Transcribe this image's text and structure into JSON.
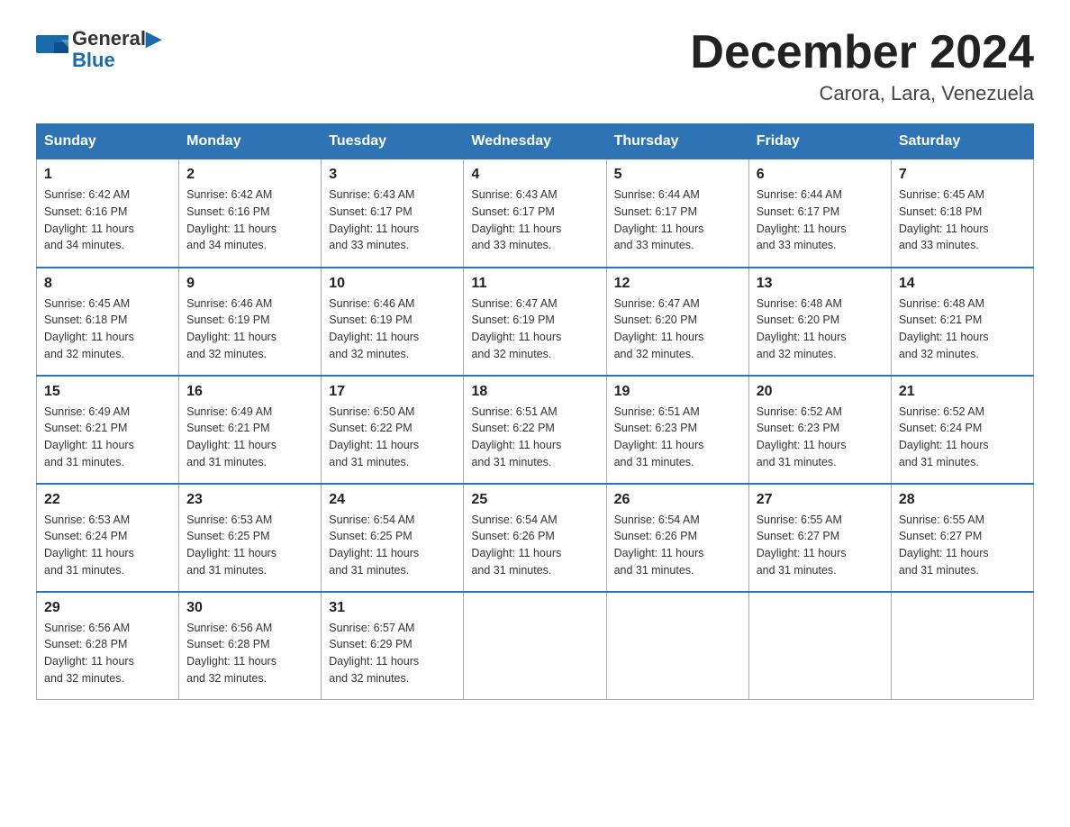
{
  "header": {
    "logo_text_general": "General",
    "logo_text_blue": "Blue",
    "title": "December 2024",
    "subtitle": "Carora, Lara, Venezuela"
  },
  "weekdays": [
    "Sunday",
    "Monday",
    "Tuesday",
    "Wednesday",
    "Thursday",
    "Friday",
    "Saturday"
  ],
  "weeks": [
    [
      {
        "day": "1",
        "sunrise": "6:42 AM",
        "sunset": "6:16 PM",
        "daylight": "11 hours and 34 minutes."
      },
      {
        "day": "2",
        "sunrise": "6:42 AM",
        "sunset": "6:16 PM",
        "daylight": "11 hours and 34 minutes."
      },
      {
        "day": "3",
        "sunrise": "6:43 AM",
        "sunset": "6:17 PM",
        "daylight": "11 hours and 33 minutes."
      },
      {
        "day": "4",
        "sunrise": "6:43 AM",
        "sunset": "6:17 PM",
        "daylight": "11 hours and 33 minutes."
      },
      {
        "day": "5",
        "sunrise": "6:44 AM",
        "sunset": "6:17 PM",
        "daylight": "11 hours and 33 minutes."
      },
      {
        "day": "6",
        "sunrise": "6:44 AM",
        "sunset": "6:17 PM",
        "daylight": "11 hours and 33 minutes."
      },
      {
        "day": "7",
        "sunrise": "6:45 AM",
        "sunset": "6:18 PM",
        "daylight": "11 hours and 33 minutes."
      }
    ],
    [
      {
        "day": "8",
        "sunrise": "6:45 AM",
        "sunset": "6:18 PM",
        "daylight": "11 hours and 32 minutes."
      },
      {
        "day": "9",
        "sunrise": "6:46 AM",
        "sunset": "6:19 PM",
        "daylight": "11 hours and 32 minutes."
      },
      {
        "day": "10",
        "sunrise": "6:46 AM",
        "sunset": "6:19 PM",
        "daylight": "11 hours and 32 minutes."
      },
      {
        "day": "11",
        "sunrise": "6:47 AM",
        "sunset": "6:19 PM",
        "daylight": "11 hours and 32 minutes."
      },
      {
        "day": "12",
        "sunrise": "6:47 AM",
        "sunset": "6:20 PM",
        "daylight": "11 hours and 32 minutes."
      },
      {
        "day": "13",
        "sunrise": "6:48 AM",
        "sunset": "6:20 PM",
        "daylight": "11 hours and 32 minutes."
      },
      {
        "day": "14",
        "sunrise": "6:48 AM",
        "sunset": "6:21 PM",
        "daylight": "11 hours and 32 minutes."
      }
    ],
    [
      {
        "day": "15",
        "sunrise": "6:49 AM",
        "sunset": "6:21 PM",
        "daylight": "11 hours and 31 minutes."
      },
      {
        "day": "16",
        "sunrise": "6:49 AM",
        "sunset": "6:21 PM",
        "daylight": "11 hours and 31 minutes."
      },
      {
        "day": "17",
        "sunrise": "6:50 AM",
        "sunset": "6:22 PM",
        "daylight": "11 hours and 31 minutes."
      },
      {
        "day": "18",
        "sunrise": "6:51 AM",
        "sunset": "6:22 PM",
        "daylight": "11 hours and 31 minutes."
      },
      {
        "day": "19",
        "sunrise": "6:51 AM",
        "sunset": "6:23 PM",
        "daylight": "11 hours and 31 minutes."
      },
      {
        "day": "20",
        "sunrise": "6:52 AM",
        "sunset": "6:23 PM",
        "daylight": "11 hours and 31 minutes."
      },
      {
        "day": "21",
        "sunrise": "6:52 AM",
        "sunset": "6:24 PM",
        "daylight": "11 hours and 31 minutes."
      }
    ],
    [
      {
        "day": "22",
        "sunrise": "6:53 AM",
        "sunset": "6:24 PM",
        "daylight": "11 hours and 31 minutes."
      },
      {
        "day": "23",
        "sunrise": "6:53 AM",
        "sunset": "6:25 PM",
        "daylight": "11 hours and 31 minutes."
      },
      {
        "day": "24",
        "sunrise": "6:54 AM",
        "sunset": "6:25 PM",
        "daylight": "11 hours and 31 minutes."
      },
      {
        "day": "25",
        "sunrise": "6:54 AM",
        "sunset": "6:26 PM",
        "daylight": "11 hours and 31 minutes."
      },
      {
        "day": "26",
        "sunrise": "6:54 AM",
        "sunset": "6:26 PM",
        "daylight": "11 hours and 31 minutes."
      },
      {
        "day": "27",
        "sunrise": "6:55 AM",
        "sunset": "6:27 PM",
        "daylight": "11 hours and 31 minutes."
      },
      {
        "day": "28",
        "sunrise": "6:55 AM",
        "sunset": "6:27 PM",
        "daylight": "11 hours and 31 minutes."
      }
    ],
    [
      {
        "day": "29",
        "sunrise": "6:56 AM",
        "sunset": "6:28 PM",
        "daylight": "11 hours and 32 minutes."
      },
      {
        "day": "30",
        "sunrise": "6:56 AM",
        "sunset": "6:28 PM",
        "daylight": "11 hours and 32 minutes."
      },
      {
        "day": "31",
        "sunrise": "6:57 AM",
        "sunset": "6:29 PM",
        "daylight": "11 hours and 32 minutes."
      },
      null,
      null,
      null,
      null
    ]
  ],
  "labels": {
    "sunrise": "Sunrise:",
    "sunset": "Sunset:",
    "daylight": "Daylight:"
  }
}
